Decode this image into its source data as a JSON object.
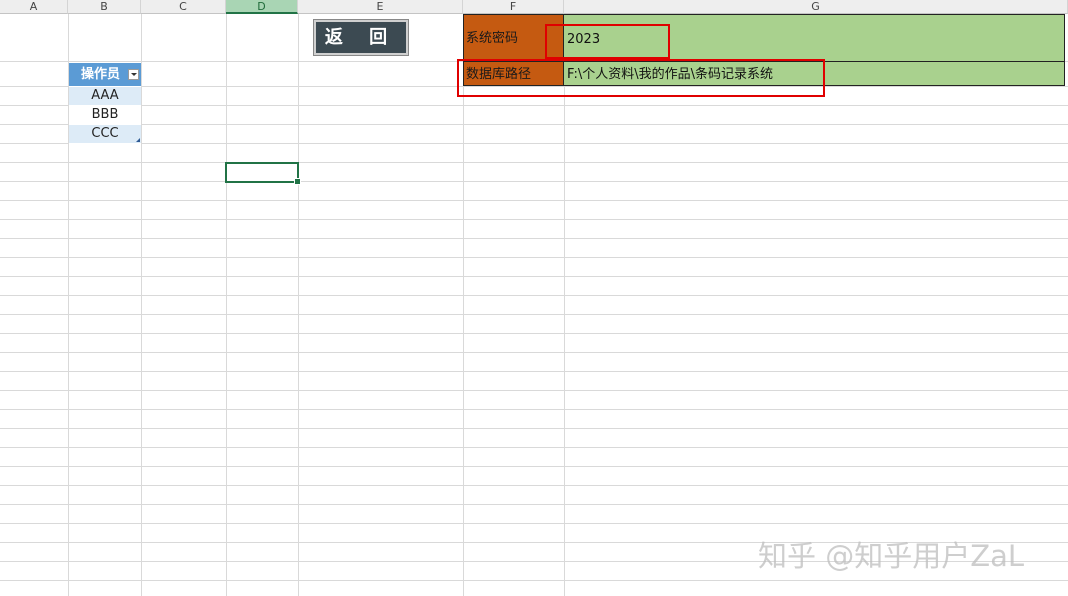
{
  "columns": [
    "A",
    "B",
    "C",
    "D",
    "E",
    "F",
    "G"
  ],
  "selected_column": "D",
  "return_button": {
    "label": "返 回"
  },
  "operator_table": {
    "header": "操作员",
    "rows": [
      "AAA",
      "BBB",
      "CCC"
    ]
  },
  "settings": {
    "password_label": "系统密码",
    "password_value": "2023",
    "db_path_label": "数据库路径",
    "db_path_value": "F:\\个人资料\\我的作品\\条码记录系统"
  },
  "colors": {
    "header_fill": "#5b9bd5",
    "label_fill": "#c55a11",
    "value_fill": "#a9d18e",
    "highlight_box": "#e00000",
    "button_fill": "#3c4a52"
  },
  "watermark": "知乎 @知乎用户ZaL"
}
